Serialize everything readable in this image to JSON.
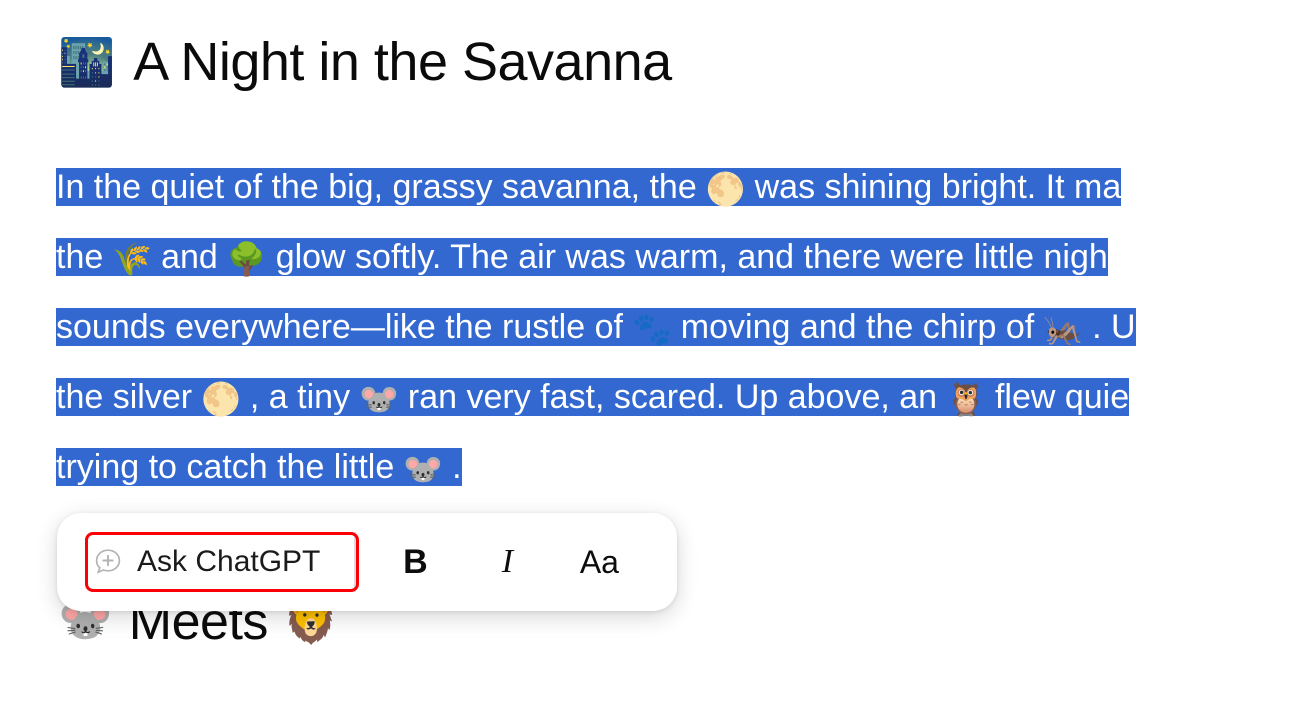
{
  "document": {
    "title_emoji": "🌃",
    "title": "A Night in the Savanna"
  },
  "body": {
    "selection_color": "#3368d0",
    "selection_text_color": "#ffffff",
    "lines": [
      {
        "segments": [
          {
            "type": "text",
            "value": "In the quiet of the big, grassy savanna, the"
          },
          {
            "type": "emoji",
            "value": "🌕"
          },
          {
            "type": "text",
            "value": "was shining bright. It ma"
          }
        ]
      },
      {
        "segments": [
          {
            "type": "text",
            "value": "the"
          },
          {
            "type": "emoji",
            "value": "🌾"
          },
          {
            "type": "text",
            "value": "and"
          },
          {
            "type": "emoji",
            "value": "🌳"
          },
          {
            "type": "text",
            "value": "glow softly. The air was warm, and there were little nigh"
          }
        ]
      },
      {
        "segments": [
          {
            "type": "text",
            "value": "sounds everywhere—like the rustle of"
          },
          {
            "type": "emoji",
            "value": "🐾"
          },
          {
            "type": "text",
            "value": "moving and the chirp of"
          },
          {
            "type": "emoji",
            "value": "🦗"
          },
          {
            "type": "text",
            "value": ". U"
          }
        ]
      },
      {
        "segments": [
          {
            "type": "text",
            "value": "the silver"
          },
          {
            "type": "emoji",
            "value": "🌕"
          },
          {
            "type": "text",
            "value": ", a tiny"
          },
          {
            "type": "emoji",
            "value": "🐭"
          },
          {
            "type": "text",
            "value": "ran very fast, scared. Up above, an"
          },
          {
            "type": "emoji",
            "value": "🦉"
          },
          {
            "type": "text",
            "value": "flew quie"
          }
        ]
      },
      {
        "segments": [
          {
            "type": "text",
            "value": "trying to catch the little"
          },
          {
            "type": "emoji",
            "value": "🐭"
          },
          {
            "type": "text",
            "value": "."
          }
        ]
      }
    ]
  },
  "toolbar": {
    "ask_label": "Ask ChatGPT",
    "ask_icon": "chat-bubble-plus-icon",
    "bold_label": "B",
    "italic_label": "I",
    "font_label": "Aa",
    "annotation_color": "#fb0007"
  },
  "sub_heading": {
    "left_emoji": "🐭",
    "text": "Meets",
    "right_emoji": "🦁"
  }
}
